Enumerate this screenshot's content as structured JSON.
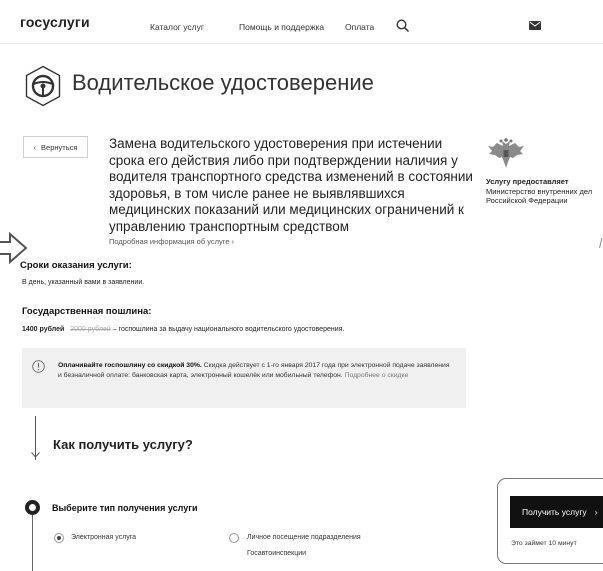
{
  "nav": {
    "logo": "госуслуги",
    "links": [
      "Каталог услуг",
      "Помощь и поддержка",
      "Оплата"
    ],
    "icons": [
      "search-icon",
      "mail-icon"
    ]
  },
  "page": {
    "title": "Водительское удостоверение",
    "back_label": "Вернуться",
    "service_title": "Замена водительского удостоверения при истечении срока его действия либо при подтверждении наличия у водителя транспортного средства изменений в состоянии здоровья, в том числе ранее не выявлявшихся медицинских показаний или медицинских ограничений к управлению транспортным средством",
    "more_info": "Подробная информация об услуге ›"
  },
  "provider": {
    "label": "Услугу предоставляет",
    "name": "Министерство внутренних дел Российской Федерации"
  },
  "terms": {
    "heading": "Сроки оказания услуги:",
    "text": "В день, указанный вами в заявлении."
  },
  "fee": {
    "heading": "Государственная пошлина:",
    "price": "1400 рублей",
    "old_price": "2000 рублей",
    "desc": " – госпошлина за выдачу национального водительского удостоверения."
  },
  "notice": {
    "bold": "Оплачивайте госпошлину со скидкой 30%.",
    "text": " Скидка действует с 1-го января 2017 года при электронной подаче заявления и безналичной оплате: банковская карта, электронный кошелёк или мобильный телефон.",
    "link": " Подробнее о скидке"
  },
  "how": {
    "title": "Как получить услугу?"
  },
  "step": {
    "title": "Выберите тип получения услуги",
    "options": [
      {
        "label": "Электронная услуга",
        "selected": true
      },
      {
        "label": "Личное посещение подразделения Госавтоинспекции",
        "selected": false
      }
    ]
  },
  "cta": {
    "button": "Получить услугу",
    "arrow": "›",
    "note": "Это займет 10 минут"
  },
  "colors": {
    "cta_bg": "#111111",
    "notice_bg": "#f0f0f0"
  }
}
